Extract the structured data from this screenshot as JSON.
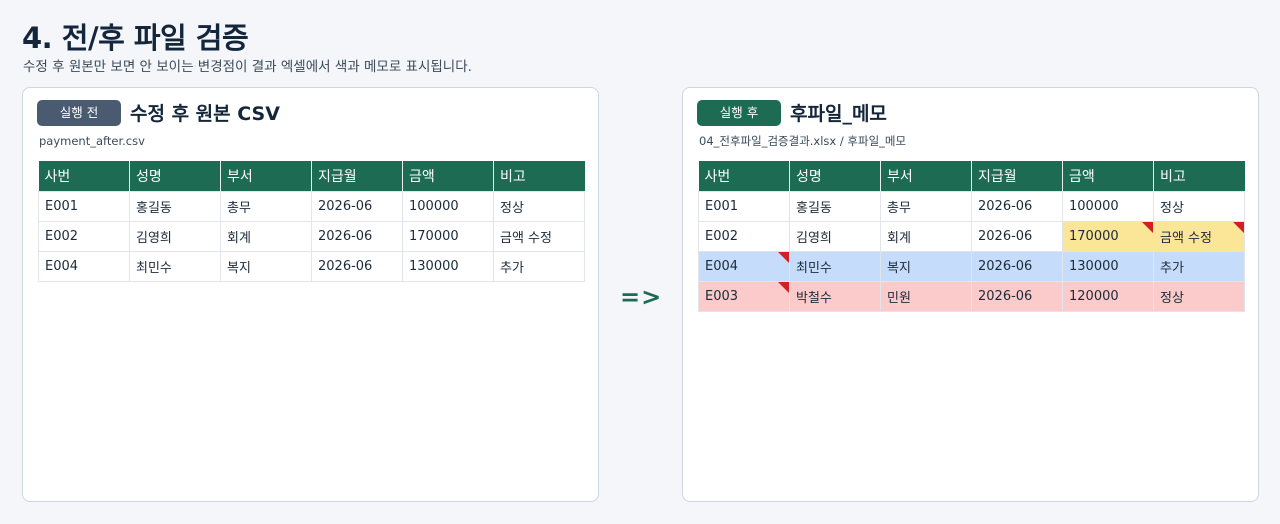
{
  "page": {
    "title": "4. 전/후 파일 검증",
    "subtitle": "수정 후 원본만 보면 안 보이는 변경점이 결과 엑셀에서 색과 메모로 표시됩니다."
  },
  "arrow": "=>",
  "left_panel": {
    "badge": "실행 전",
    "title": "수정 후 원본 CSV",
    "subtitle": "payment_after.csv",
    "columns": [
      "사번",
      "성명",
      "부서",
      "지급월",
      "금액",
      "비고"
    ],
    "rows": [
      {
        "cells": [
          "E001",
          "홍길동",
          "총무",
          "2026-06",
          "100000",
          "정상"
        ]
      },
      {
        "cells": [
          "E002",
          "김영희",
          "회계",
          "2026-06",
          "170000",
          "금액 수정"
        ]
      },
      {
        "cells": [
          "E004",
          "최민수",
          "복지",
          "2026-06",
          "130000",
          "추가"
        ]
      }
    ]
  },
  "right_panel": {
    "badge": "실행 후",
    "title": "후파일_메모",
    "subtitle": "04_전후파일_검증결과.xlsx / 후파일_메모",
    "columns": [
      "사번",
      "성명",
      "부서",
      "지급월",
      "금액",
      "비고"
    ],
    "rows": [
      {
        "cells": [
          "E001",
          "홍길동",
          "총무",
          "2026-06",
          "100000",
          "정상"
        ],
        "status": "unchanged",
        "row_color": null,
        "highlight_cells": [],
        "memo_cells": []
      },
      {
        "cells": [
          "E002",
          "김영희",
          "회계",
          "2026-06",
          "170000",
          "금액 수정"
        ],
        "status": "modified",
        "row_color": null,
        "highlight_cells": [
          4,
          5
        ],
        "memo_cells": [
          4,
          5
        ]
      },
      {
        "cells": [
          "E004",
          "최민수",
          "복지",
          "2026-06",
          "130000",
          "추가"
        ],
        "status": "added",
        "row_color": "#c5dcfb",
        "highlight_cells": [],
        "memo_cells": [
          0
        ]
      },
      {
        "cells": [
          "E003",
          "박철수",
          "민원",
          "2026-06",
          "120000",
          "정상"
        ],
        "status": "deleted",
        "row_color": "#fbcaca",
        "highlight_cells": [],
        "memo_cells": [
          0
        ]
      }
    ]
  },
  "colors": {
    "header_green": "#1d6b53",
    "badge_before": "#4a5a70",
    "modified_yellow": "#fbe596",
    "added_blue": "#c5dcfb",
    "deleted_pink": "#fbcaca",
    "memo_marker_red": "#d21f26"
  }
}
